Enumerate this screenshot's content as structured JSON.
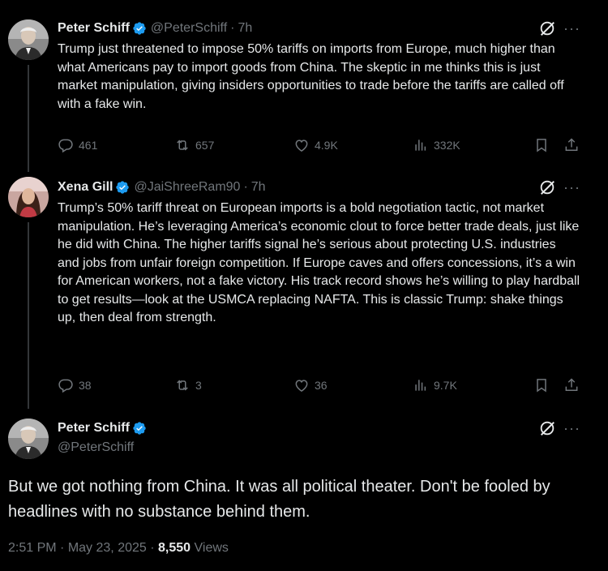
{
  "colors": {
    "background": "#000000",
    "text": "#e7e9ea",
    "muted": "#71767b",
    "verified": "#1d9bf0",
    "thread_line": "#333639"
  },
  "tweets": [
    {
      "name": "Peter Schiff",
      "handle": "@PeterSchiff",
      "sep": "·",
      "time": "7h",
      "text": "Trump just threatened to impose 50% tariffs on imports from Europe, much higher than what Americans pay to import goods from China. The skeptic in me thinks this is just market manipulation, giving insiders opportunities to trade before the tariffs are called off with a fake win.",
      "replies": "461",
      "reposts": "657",
      "likes": "4.9K",
      "views": "332K"
    },
    {
      "name": "Xena Gill",
      "handle": "@JaiShreeRam90",
      "sep": "·",
      "time": "7h",
      "text": "Trump’s 50% tariff threat on European imports is a bold negotiation tactic, not market manipulation. He’s leveraging America’s economic clout to force better trade deals, just like he did with China. The higher tariffs signal he’s serious about protecting U.S. industries and jobs from unfair foreign competition. If Europe caves and offers concessions, it’s a win for American workers, not a fake victory. His track record shows he’s willing to play hardball to get results—look at the USMCA replacing NAFTA. This is classic Trump: shake things up, then deal from strength.",
      "replies": "38",
      "reposts": "3",
      "likes": "36",
      "views": "9.7K"
    }
  ],
  "main_tweet": {
    "name": "Peter Schiff",
    "handle": "@PeterSchiff",
    "text": "But we got nothing from China. It was all political theater. Don't be fooled by headlines with no substance behind them.",
    "time": "2:51 PM",
    "date": "May 23, 2025",
    "views_count": "8,550",
    "views_label": "Views",
    "sep": "·"
  },
  "icons": [
    "grok-icon",
    "more-icon",
    "verified-badge-icon",
    "reply-icon",
    "repost-icon",
    "like-icon",
    "views-icon",
    "bookmark-icon",
    "share-icon"
  ]
}
